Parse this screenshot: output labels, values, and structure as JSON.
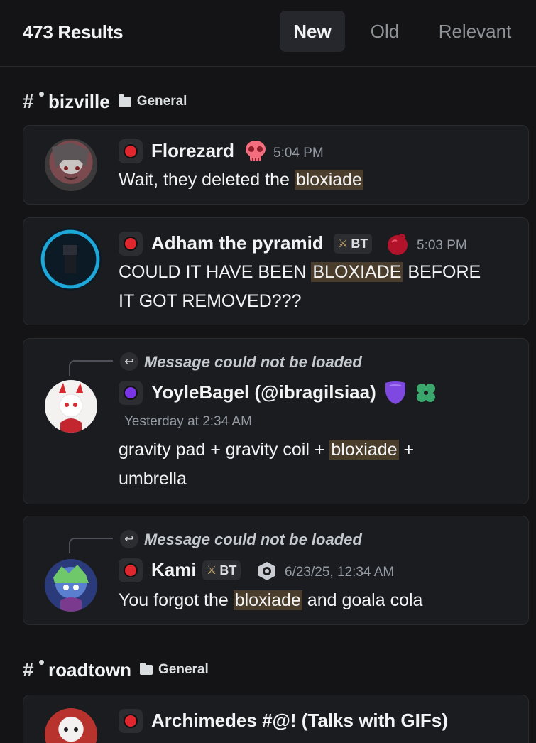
{
  "header": {
    "results_count": "473 Results",
    "tabs": [
      {
        "label": "New",
        "active": true
      },
      {
        "label": "Old",
        "active": false
      },
      {
        "label": "Relevant",
        "active": false
      }
    ]
  },
  "groups": [
    {
      "channel": "bizville",
      "category": "General",
      "messages": [
        {
          "author": "Florezard",
          "role_color": "#e0272e",
          "badge_icon": "skull-icon",
          "time": "5:04 PM",
          "text_parts": [
            "Wait,  they deleted the ",
            "bloxiade",
            ""
          ]
        },
        {
          "author": "Adham the pyramid",
          "role_color": "#e0272e",
          "tag": "BT",
          "badge_icon": "apple-icon",
          "time": "5:03 PM",
          "text_lines": [
            "COULD IT HAVE BEEN ",
            "BLOXIADE",
            " BEFORE",
            "IT GOT REMOVED???"
          ]
        },
        {
          "reply_note": "Message could not be loaded",
          "author": "YoyleBagel (@ibragilsiaa)",
          "role_color": "#7a35e6",
          "badge_icon": "shield-icon",
          "badge_icon_2": "clover-icon",
          "time": "Yesterday at 2:34 AM",
          "text_lines": [
            "gravity pad + gravity coil + ",
            "bloxiade",
            " +",
            "umbrella"
          ]
        },
        {
          "reply_note": "Message could not be loaded",
          "author": "Kami",
          "role_color": "#e0272e",
          "tag": "BT",
          "badge_icon": "ring-icon",
          "time": "6/23/25, 12:34 AM",
          "text_parts": [
            "You forgot the ",
            "bloxiade",
            " and goala cola"
          ]
        }
      ]
    },
    {
      "channel": "roadtown",
      "category": "General",
      "messages": [
        {
          "author": "Archimedes #@! (Talks with GIFs)",
          "role_color": "#e0272e"
        }
      ]
    }
  ]
}
